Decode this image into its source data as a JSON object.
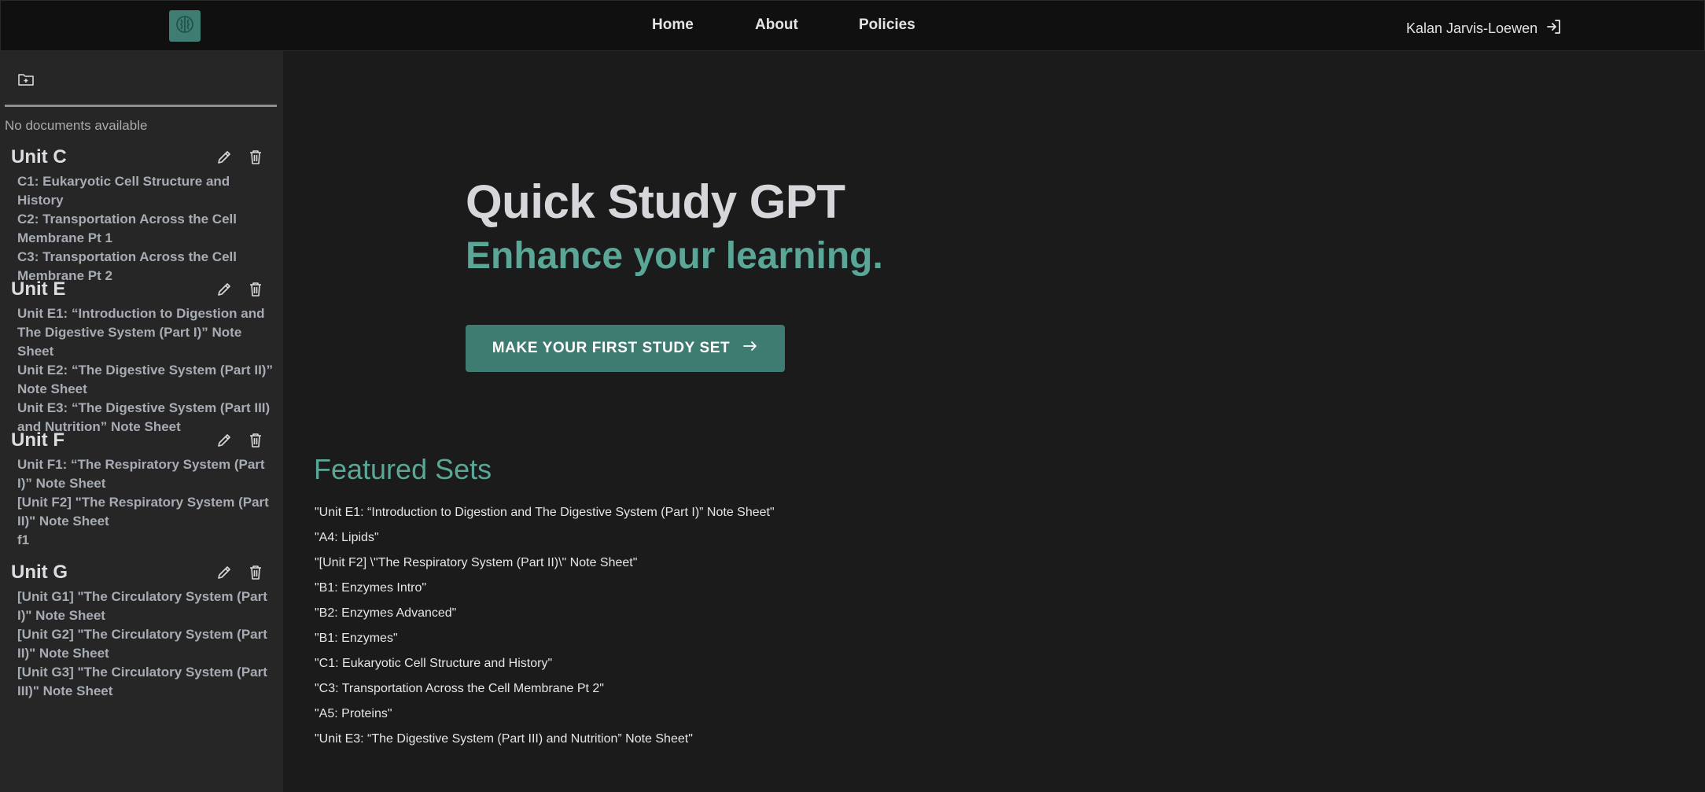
{
  "nav": {
    "logo_icon": "brain-icon",
    "links": [
      "Home",
      "About",
      "Policies"
    ],
    "user_name": "Kalan Jarvis-Loewen",
    "user_icon": "sign-in-icon"
  },
  "sidebar": {
    "new_folder_icon": "folder-plus-icon",
    "no_docs": "No documents available",
    "units": [
      {
        "title": "Unit C",
        "docs": [
          "C1: Eukaryotic Cell Structure and History",
          "C2: Transportation Across the Cell Membrane Pt 1",
          "C3: Transportation Across the Cell Membrane Pt 2"
        ]
      },
      {
        "title": "Unit E",
        "docs": [
          "Unit E1: “Introduction to Digestion and The Digestive System (Part I)” Note Sheet",
          "Unit E2: “The Digestive System (Part II)” Note Sheet",
          "Unit E3: “The Digestive System (Part III) and Nutrition” Note Sheet"
        ]
      },
      {
        "title": "Unit F",
        "docs": [
          "Unit F1: “The Respiratory System (Part I)” Note Sheet",
          "[Unit F2] \"The Respiratory System (Part II)\" Note Sheet",
          "f1"
        ]
      },
      {
        "title": "Unit G",
        "docs": [
          "[Unit G1] \"The Circulatory System (Part I)\" Note Sheet",
          "[Unit G2] \"The Circulatory System (Part II)\" Note Sheet",
          "[Unit G3] \"The Circulatory System (Part III)\" Note Sheet"
        ]
      }
    ]
  },
  "hero": {
    "title": "Quick Study GPT",
    "subtitle": "Enhance your learning.",
    "cta_label": "MAKE YOUR FIRST STUDY SET",
    "cta_icon": "arrow-right-icon"
  },
  "featured": {
    "title": "Featured Sets",
    "items": [
      "\"Unit E1: “Introduction to Digestion and The Digestive System (Part I)” Note Sheet\"",
      "\"A4: Lipids\"",
      "\"[Unit F2] \\\"The Respiratory System (Part II)\\\" Note Sheet\"",
      "\"B1: Enzymes Intro\"",
      "\"B2: Enzymes Advanced\"",
      "\"B1: Enzymes\"",
      "\"C1: Eukaryotic Cell Structure and History\"",
      "\"C3: Transportation Across the Cell Membrane Pt 2\"",
      "\"A5: Proteins\"",
      "\"Unit E3: “The Digestive System (Part III) and Nutrition” Note Sheet\""
    ]
  },
  "colors": {
    "accent": "#5ba797",
    "button": "#3e7b71",
    "background": "#1b1b1b",
    "sidebar": "#262626",
    "topbar": "#101010"
  }
}
